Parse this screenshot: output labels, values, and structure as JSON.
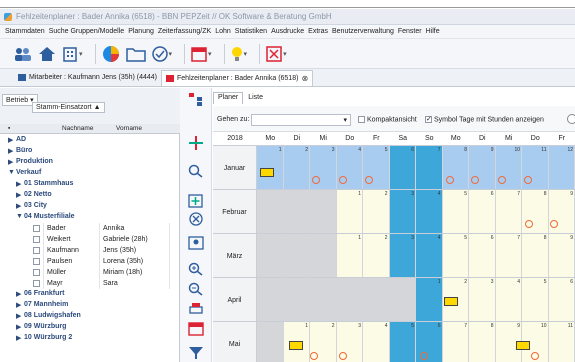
{
  "window": {
    "title": "Fehlzeitenplaner : Bader Annika (6518) - BBN PEPZeit // OK Software & Beratung GmbH"
  },
  "menu": [
    "Stammdaten",
    "Suche Gruppen/Modelle",
    "Planung",
    "Zeiterfassung/ZK",
    "Lohn",
    "Statistiken",
    "Ausdrucke",
    "Extras",
    "Benutzerverwaltung",
    "Fenster",
    "Hilfe"
  ],
  "tabs": [
    {
      "label": "Mitarbeiter : Kaufmann Jens (35h) (4444)"
    },
    {
      "label": "Fehlzeitenplaner : Bader Annika (6518)"
    }
  ],
  "groupbar": {
    "btn1": "Betrieb",
    "btn2": "Stamm-Einsatzort"
  },
  "tableHead": {
    "name": "Nachname",
    "first": "Vorname"
  },
  "tree": [
    {
      "label": "AD",
      "level": 0,
      "state": "▶"
    },
    {
      "label": "Büro",
      "level": 0,
      "state": "▶"
    },
    {
      "label": "Produktion",
      "level": 0,
      "state": "▶"
    },
    {
      "label": "Verkauf",
      "level": 0,
      "state": "▼"
    },
    {
      "label": "01 Stammhaus",
      "level": 1,
      "state": "▶"
    },
    {
      "label": "02 Netto",
      "level": 1,
      "state": "▶"
    },
    {
      "label": "03 City",
      "level": 1,
      "state": "▶"
    },
    {
      "label": "04 Musterfiliale",
      "level": 1,
      "state": "▼"
    }
  ],
  "employees": [
    {
      "last": "Bader",
      "first": "Annika"
    },
    {
      "last": "Weikert",
      "first": "Gabriele (28h)"
    },
    {
      "last": "Kaufmann",
      "first": "Jens (35h)"
    },
    {
      "last": "Paulsen",
      "first": "Lorena (35h)"
    },
    {
      "last": "Müller",
      "first": "Miriam (18h)"
    },
    {
      "last": "Mayr",
      "first": "Sara"
    }
  ],
  "tree2": [
    {
      "label": "06 Frankfurt",
      "state": "▶"
    },
    {
      "label": "07 Mannheim",
      "state": "▶"
    },
    {
      "label": "08 Ludwigshafen",
      "state": "▶"
    },
    {
      "label": "09 Würzburg",
      "state": "▶"
    },
    {
      "label": "10 Würzburg 2",
      "state": "▶"
    }
  ],
  "planner": {
    "subtabs": [
      "Planer",
      "Liste"
    ],
    "gehen_label": "Gehen zu:",
    "kompakt": "Kompaktansicht",
    "symbol": "Symbol Tage mit Stunden anzeigen",
    "year": "2018",
    "weekdays": [
      "Mo",
      "Di",
      "Mi",
      "Do",
      "Fr",
      "Sa",
      "So",
      "Mo",
      "Di",
      "Mi",
      "Do",
      "Fr"
    ],
    "months": [
      "Januar",
      "Februar",
      "März",
      "April",
      "Mai"
    ],
    "colors": {
      "weekend": "#3ca7d8",
      "workday": "#fbfbe6",
      "selected": "#a8ccef",
      "empty": "#d4d6da"
    }
  }
}
